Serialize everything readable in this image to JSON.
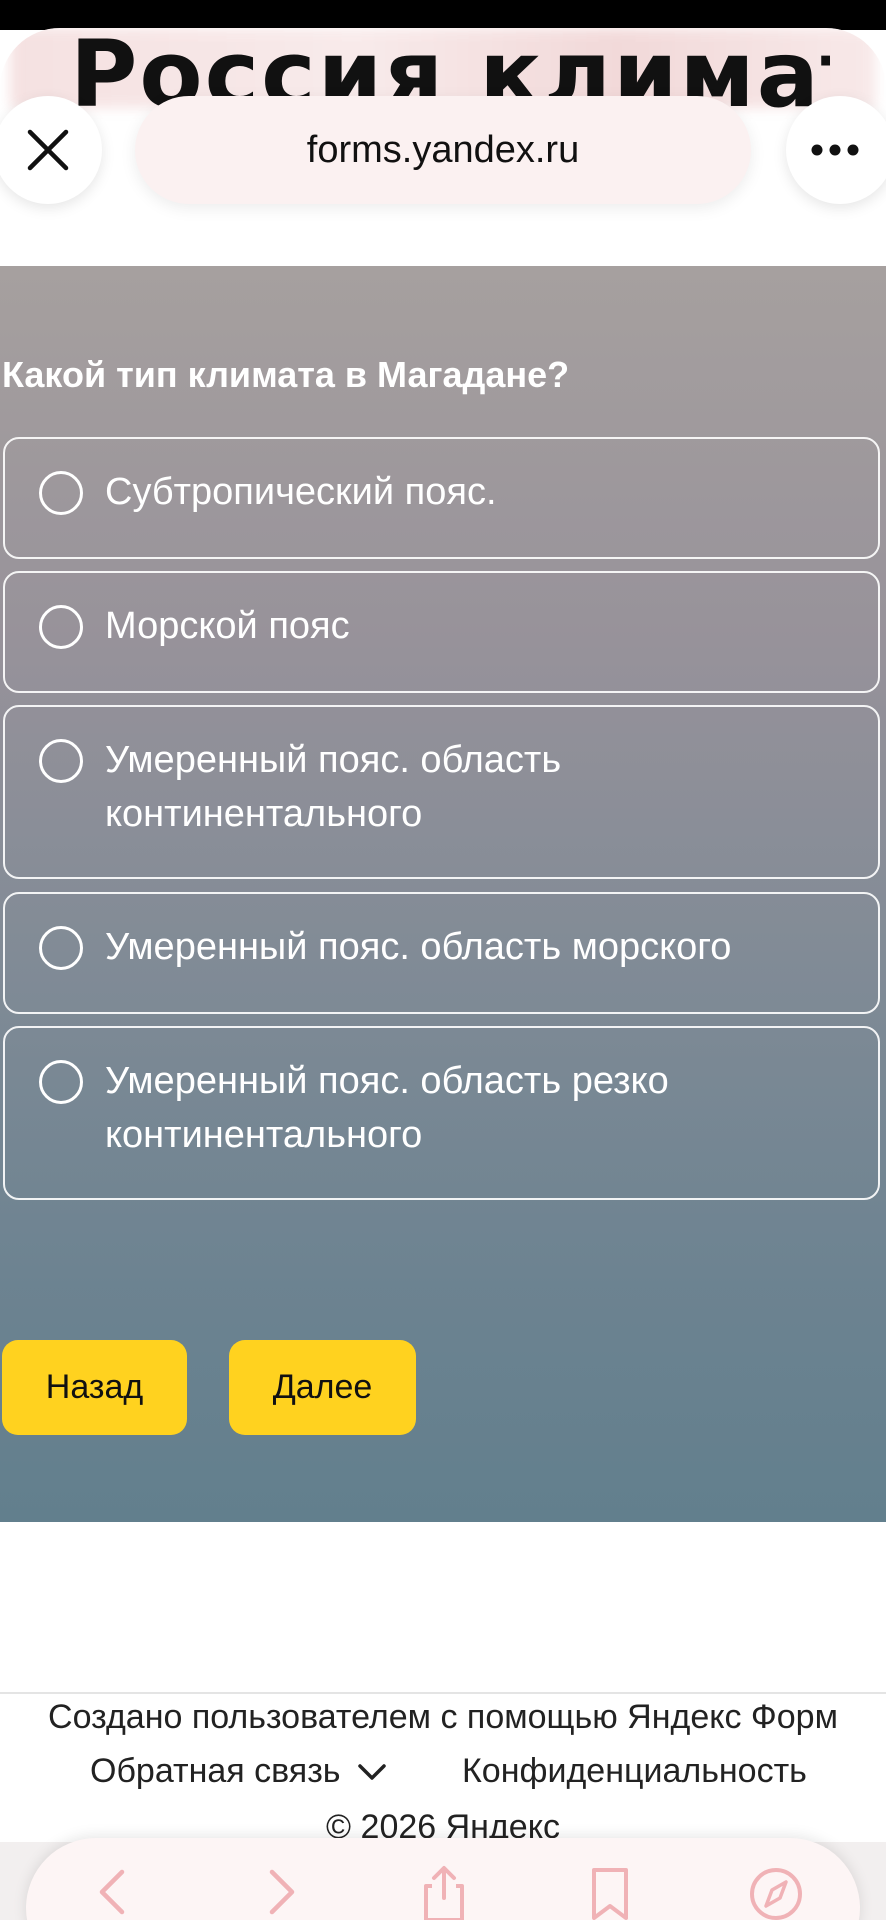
{
  "browser": {
    "page_heading": "Россия климат",
    "url": "forms.yandex.ru",
    "close_icon": "close-icon",
    "more_icon": "more-icon"
  },
  "form": {
    "question": "Какой тип климата в Магадане?",
    "options": [
      {
        "label": "Субтропический пояс.",
        "selected": false
      },
      {
        "label": "Морской пояс",
        "selected": false
      },
      {
        "label": "Умеренный пояс. область континентального",
        "selected": false
      },
      {
        "label": "Умеренный пояс. область морского",
        "selected": false
      },
      {
        "label": "Умеренный пояс. область резко континентального",
        "selected": false
      }
    ],
    "back_label": "Назад",
    "next_label": "Далее",
    "button_color": "#ffd21f"
  },
  "footer": {
    "created_by": "Создано пользователем с помощью Яндекс Форм",
    "feedback": "Обратная связь",
    "privacy": "Конфиденциальность",
    "copyright": "© 2026 Яндекс"
  },
  "toolbar": {
    "icons": [
      "back-icon",
      "forward-icon",
      "share-icon",
      "bookmarks-icon",
      "compass-icon"
    ]
  }
}
